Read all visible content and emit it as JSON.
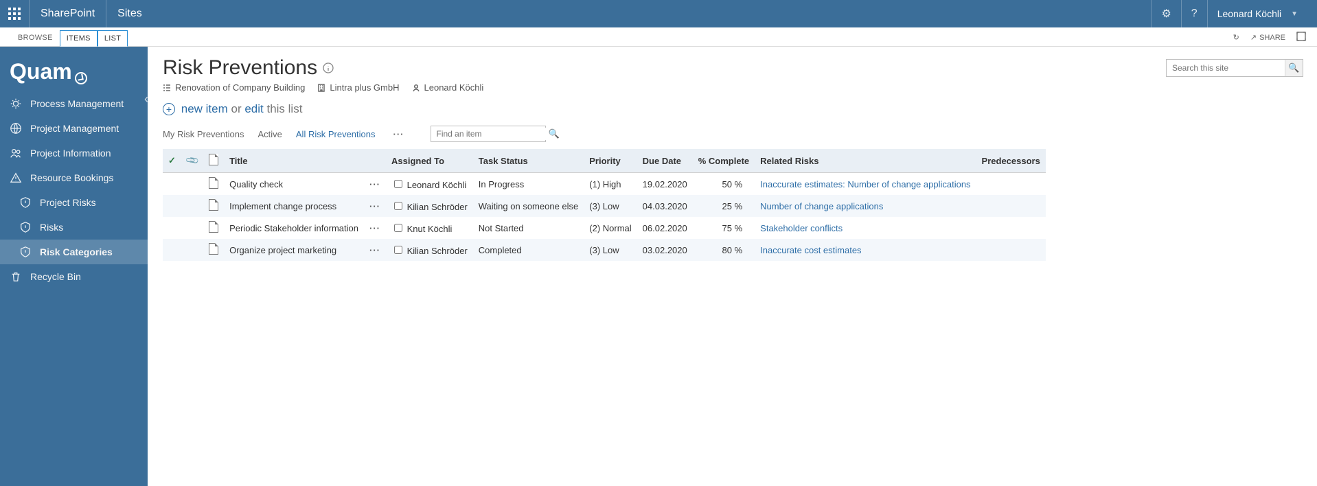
{
  "suitebar": {
    "sharepoint": "SharePoint",
    "sites": "Sites",
    "user": "Leonard Köchli"
  },
  "ribbon": {
    "tabs": [
      "BROWSE",
      "ITEMS",
      "LIST"
    ],
    "share": "SHARE"
  },
  "sidebar": {
    "logo": "Quam",
    "items": [
      {
        "label": "Process Management"
      },
      {
        "label": "Project Management"
      },
      {
        "label": "Project Information"
      },
      {
        "label": "Resource Bookings"
      },
      {
        "label": "Project Risks",
        "indent": true
      },
      {
        "label": "Risks",
        "indent": true
      },
      {
        "label": "Risk Categories",
        "indent": true,
        "selected": true
      },
      {
        "label": "Recycle Bin"
      }
    ]
  },
  "page": {
    "title": "Risk Preventions",
    "breadcrumb": {
      "project": "Renovation of Company Building",
      "org": "Lintra plus GmbH",
      "user": "Leonard Köchli"
    },
    "search_placeholder": "Search this site",
    "newitem_new": "new item",
    "newitem_mid": " or ",
    "newitem_edit": "edit",
    "newitem_tail": " this list",
    "views": [
      "My Risk Preventions",
      "Active",
      "All Risk Preventions"
    ],
    "active_view": "All Risk Preventions",
    "find_placeholder": "Find an item"
  },
  "table": {
    "headers": {
      "title": "Title",
      "assigned": "Assigned To",
      "status": "Task Status",
      "priority": "Priority",
      "due": "Due Date",
      "complete": "% Complete",
      "risks": "Related Risks",
      "pred": "Predecessors"
    },
    "rows": [
      {
        "title": "Quality check",
        "assigned": "Leonard Köchli",
        "status": "In Progress",
        "priority": "(1) High",
        "due": "19.02.2020",
        "complete": "50 %",
        "risks": "Inaccurate estimates: Number of change applications"
      },
      {
        "title": "Implement change process",
        "assigned": "Kilian Schröder",
        "status": "Waiting on someone else",
        "priority": "(3) Low",
        "due": "04.03.2020",
        "complete": "25 %",
        "risks": "Number of change applications"
      },
      {
        "title": "Periodic Stakeholder information",
        "assigned": "Knut Köchli",
        "status": "Not Started",
        "priority": "(2) Normal",
        "due": "06.02.2020",
        "complete": "75 %",
        "risks": "Stakeholder conflicts"
      },
      {
        "title": "Organize project marketing",
        "assigned": "Kilian Schröder",
        "status": "Completed",
        "priority": "(3) Low",
        "due": "03.02.2020",
        "complete": "80 %",
        "risks": "Inaccurate cost estimates"
      }
    ]
  }
}
